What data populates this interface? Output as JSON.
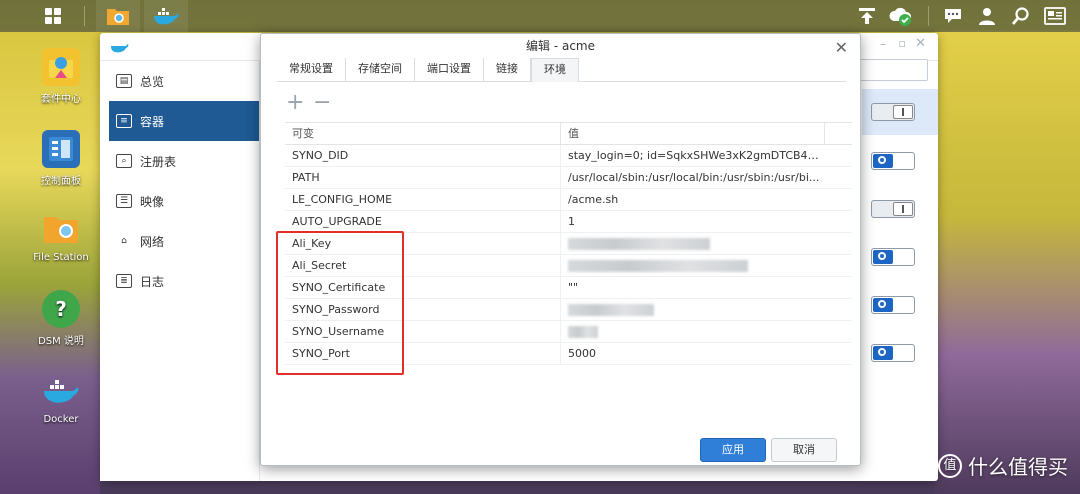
{
  "desktop": {
    "icons": [
      {
        "label": "套件中心",
        "icon": "package-center-icon"
      },
      {
        "label": "控制面板",
        "icon": "control-panel-icon"
      },
      {
        "label": "File Station",
        "icon": "folder-icon"
      },
      {
        "label": "DSM 说明",
        "icon": "help-icon"
      },
      {
        "label": "Docker",
        "icon": "docker-icon"
      }
    ]
  },
  "taskbar": {
    "icons": [
      "main-menu-icon",
      "file-station-icon",
      "docker-icon",
      "upload-icon",
      "cloud-sync-icon",
      "chat-icon",
      "user-icon",
      "search-icon",
      "widgets-icon"
    ]
  },
  "sidebar": {
    "items": [
      {
        "label": "总览",
        "icon": "overview-icon"
      },
      {
        "label": "容器",
        "icon": "container-icon",
        "active": true
      },
      {
        "label": "注册表",
        "icon": "registry-icon"
      },
      {
        "label": "映像",
        "icon": "image-icon"
      },
      {
        "label": "网络",
        "icon": "network-icon"
      },
      {
        "label": "日志",
        "icon": "log-icon"
      }
    ]
  },
  "container_toggles": [
    "off",
    "on",
    "off",
    "on",
    "on",
    "on"
  ],
  "dialog": {
    "title": "编辑 - acme",
    "tabs": [
      "常规设置",
      "存储空间",
      "端口设置",
      "链接",
      "环境"
    ],
    "active_tab": "环境",
    "toolbar": {
      "add": "+",
      "remove": "−"
    },
    "columns": {
      "variable": "可变",
      "value": "值"
    },
    "rows": [
      {
        "key": "SYNO_DID",
        "value": "stay_login=0; id=SqkxSHWe3xK2gmDTCB4AJr..."
      },
      {
        "key": "PATH",
        "value": "/usr/local/sbin:/usr/local/bin:/usr/sbin:/usr/bi..."
      },
      {
        "key": "LE_CONFIG_HOME",
        "value": "/acme.sh"
      },
      {
        "key": "AUTO_UPGRADE",
        "value": "1"
      },
      {
        "key": "Ali_Key",
        "value": ""
      },
      {
        "key": "Ali_Secret",
        "value": ""
      },
      {
        "key": "SYNO_Certificate",
        "value": "\"\""
      },
      {
        "key": "SYNO_Password",
        "value": ""
      },
      {
        "key": "SYNO_Username",
        "value": ""
      },
      {
        "key": "SYNO_Port",
        "value": "5000"
      }
    ],
    "apply_label": "应用",
    "cancel_label": "取消"
  },
  "watermark": {
    "text": "什么值得买",
    "logo": "值"
  },
  "colors": {
    "accent": "#2f7ed8",
    "sidebar_active": "#1f5a94",
    "highlight_border": "#e0302a"
  }
}
